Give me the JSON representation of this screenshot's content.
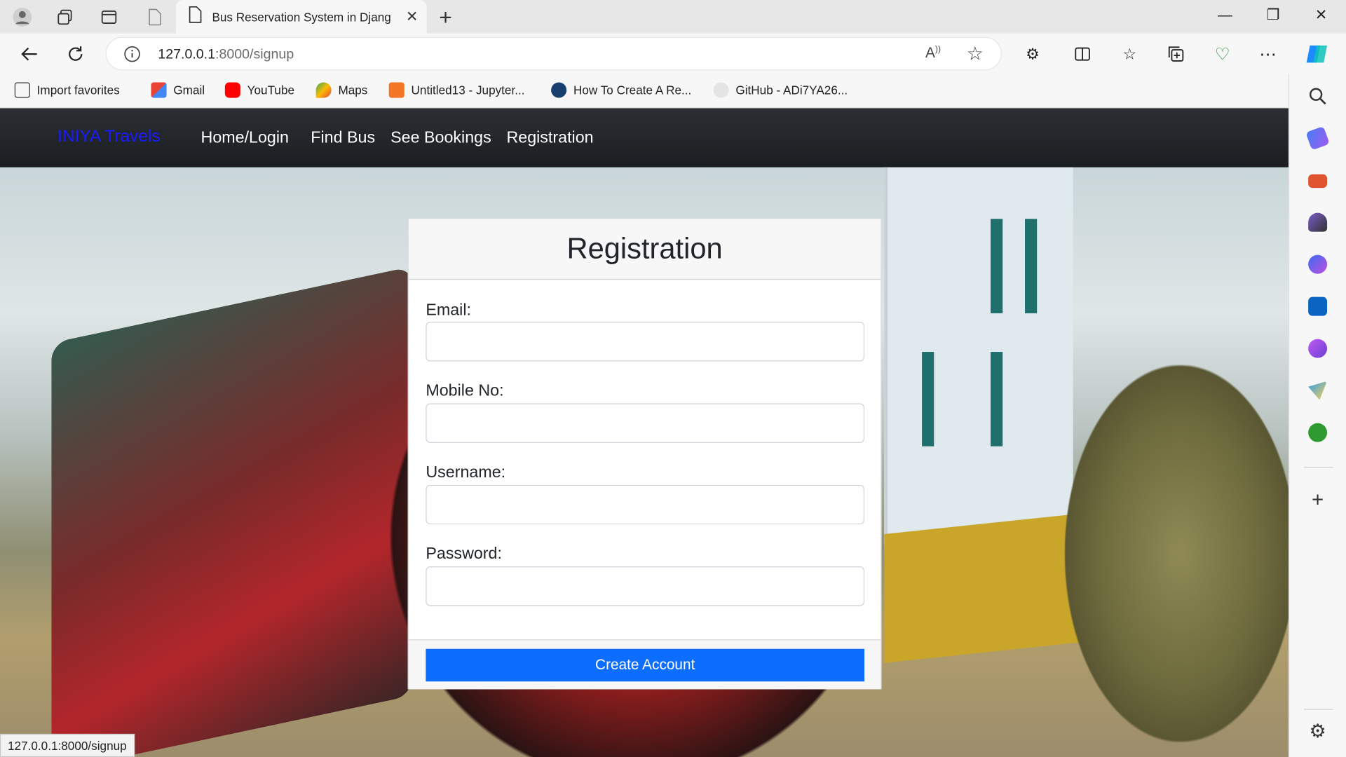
{
  "browser": {
    "tab_title": "Bus Reservation System in Djang",
    "url_host": "127.0.0.1",
    "url_path": ":8000/signup",
    "status_url": "127.0.0.1:8000/signup",
    "bookmarks": [
      {
        "label": "Import favorites",
        "icon": "import-icon"
      },
      {
        "label": "Gmail",
        "icon": "gmail-icon",
        "color": "#d93025"
      },
      {
        "label": "YouTube",
        "icon": "youtube-icon",
        "color": "#ff0000"
      },
      {
        "label": "Maps",
        "icon": "maps-icon",
        "color": "#34a853"
      },
      {
        "label": "Untitled13 - Jupyter...",
        "icon": "jupyter-icon",
        "color": "#f37626"
      },
      {
        "label": "How To Create A Re...",
        "icon": "site-icon",
        "color": "#1a3e6e"
      },
      {
        "label": "GitHub - ADi7YA26...",
        "icon": "github-icon",
        "color": "#dddddd"
      }
    ]
  },
  "site": {
    "brand": "INIYA Travels",
    "nav": [
      "Home/Login",
      "Find Bus",
      "See Bookings",
      "Registration"
    ]
  },
  "form": {
    "title": "Registration",
    "fields": [
      {
        "label": "Email:",
        "value": ""
      },
      {
        "label": "Mobile No:",
        "value": ""
      },
      {
        "label": "Username:",
        "value": ""
      },
      {
        "label": "Password:",
        "value": ""
      }
    ],
    "submit_label": "Create Account"
  },
  "colors": {
    "brand": "#1a1aff",
    "primary_button": "#0d6efd",
    "navbar": "#212529"
  }
}
